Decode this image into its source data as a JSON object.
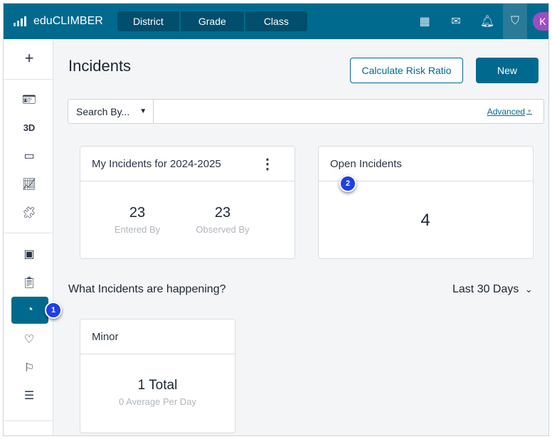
{
  "topbar": {
    "app_name": "eduCLIMBER",
    "scopes": [
      "District",
      "Grade",
      "Class"
    ],
    "avatar_initial": "K",
    "icons": [
      "calendar-icon",
      "mail-icon",
      "bell-icon",
      "shield-r-icon"
    ]
  },
  "sidebar": {
    "add": "+",
    "label_3d": "3D",
    "active_badge": "1"
  },
  "page": {
    "title": "Incidents",
    "calc_button": "Calculate Risk Ratio",
    "new_button": "New"
  },
  "search": {
    "by_label": "Search By...",
    "advanced": "Advanced"
  },
  "my_incidents": {
    "title": "My Incidents for 2024-2025",
    "entered_value": "23",
    "entered_label": "Entered By",
    "observed_value": "23",
    "observed_label": "Observed By"
  },
  "open_incidents": {
    "title": "Open Incidents",
    "value": "4",
    "badge": "2"
  },
  "happening": {
    "title": "What Incidents are happening?",
    "range": "Last 30 Days"
  },
  "minor": {
    "title": "Minor",
    "total": "1 Total",
    "average": "0 Average Per Day"
  },
  "colors": {
    "brand": "#006a8e",
    "badge": "#1e3fe6"
  }
}
